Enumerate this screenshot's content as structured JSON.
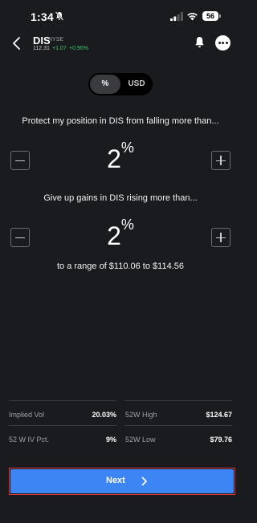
{
  "status_bar": {
    "time": "1:34",
    "battery": "56"
  },
  "header": {
    "symbol": "DIS",
    "exchange": "NYSE",
    "price": "112.31",
    "change": "+1.07",
    "change_pct": "+0.96%"
  },
  "unit_toggle": {
    "options": [
      "%",
      "USD"
    ],
    "selected": "%"
  },
  "protect": {
    "prompt": "Protect my position in DIS from falling more than...",
    "value": "2",
    "unit": "%"
  },
  "gains": {
    "prompt": "Give up gains in DIS rising more than...",
    "value": "2",
    "unit": "%"
  },
  "range_text": "to a range of $110.06 to $114.56",
  "stats": {
    "implied_vol_label": "Implied Vol",
    "implied_vol_value": "20.03%",
    "high_52w_label": "52W High",
    "high_52w_value": "$124.67",
    "iv_pct_label": "52 W IV Pct.",
    "iv_pct_value": "9%",
    "low_52w_label": "52W Low",
    "low_52w_value": "$79.76"
  },
  "next_button": {
    "label": "Next"
  },
  "colors": {
    "background": "#1a1b1e",
    "accent": "#3d84f5",
    "positive": "#3ec46d",
    "highlight_border": "#e53935"
  }
}
